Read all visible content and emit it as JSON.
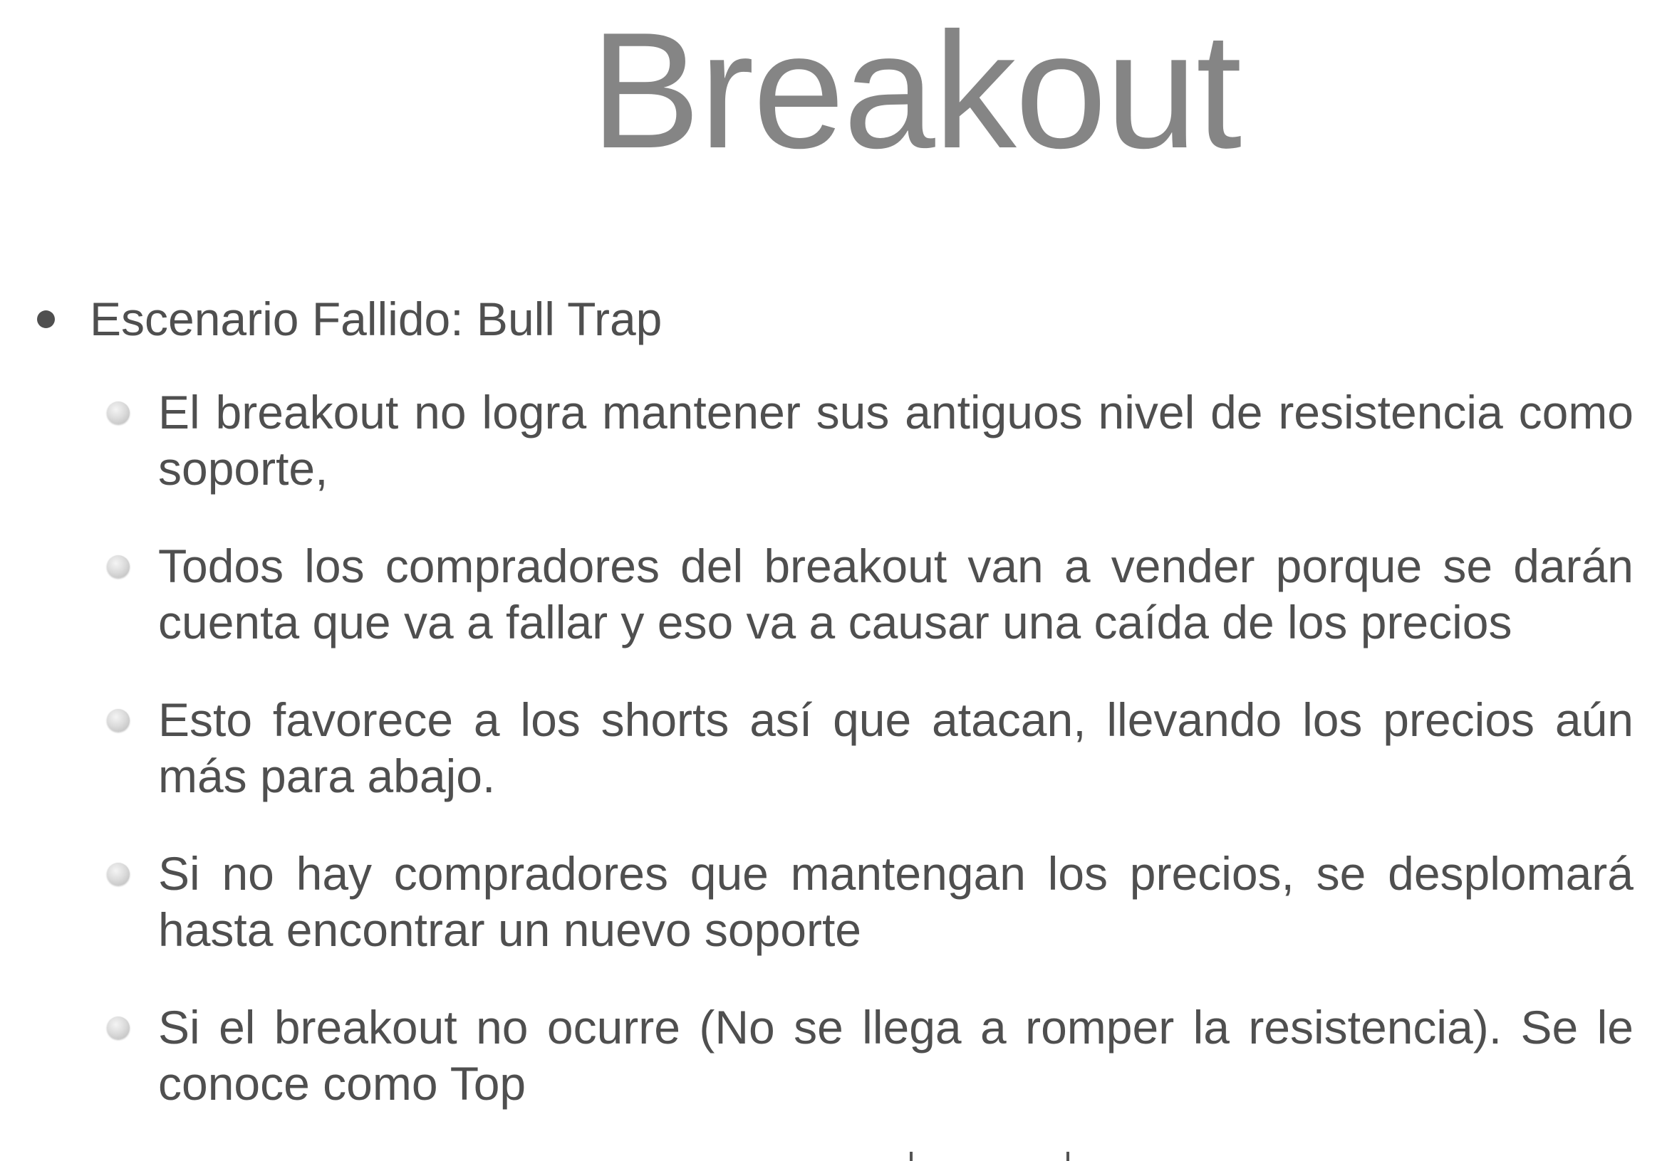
{
  "slide": {
    "title": "Breakout",
    "main_bullet": "Escenario Fallido: Bull Trap",
    "sub_bullets": [
      "El breakout no logra mantener sus antiguos nivel de resistencia como soporte,",
      "Todos los compradores del breakout van a vender porque se darán cuenta que va a fallar y eso va a causar una caída de los precios",
      "Esto favorece a los shorts así que atacan, llevando los precios aún más para abajo.",
      "Si no hay compradores que mantengan los precios, se desplomará hasta encontrar un nuevo soporte",
      "Si el breakout no ocurre (No se llega a romper la resistencia). Se le conoce como Top"
    ]
  },
  "colors": {
    "title": "#858585",
    "text": "#4f4f4f",
    "background": "#ffffff"
  },
  "icons": {
    "main_bullet": "filled-circle-bullet-icon",
    "sub_bullet": "gray-sphere-bullet-icon"
  }
}
